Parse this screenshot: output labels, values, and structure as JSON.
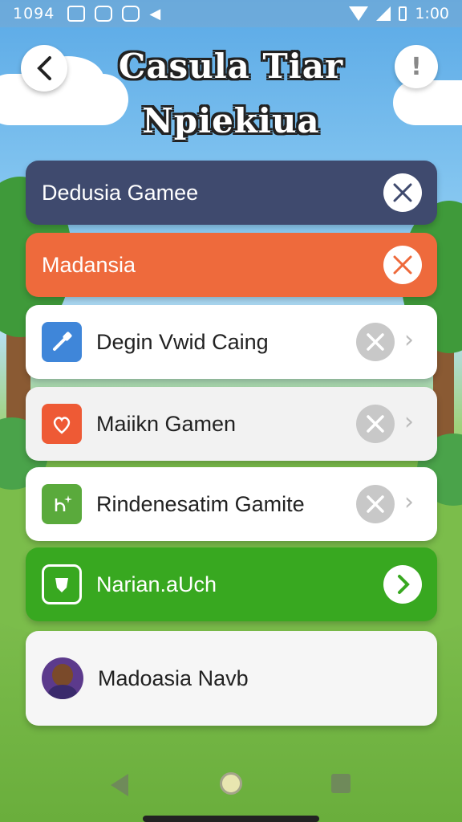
{
  "status_bar": {
    "time_left": "1094",
    "time_right": "1:00"
  },
  "header": {
    "title_line1": "Casula Tiar",
    "title_line2": "Npiekiua",
    "help_label": "!"
  },
  "rows": [
    {
      "label": "Dedusia Gamee",
      "action": "close",
      "style": "navy"
    },
    {
      "label": "Madansia",
      "action": "close",
      "style": "orange"
    },
    {
      "label": "Degin Vwid Caing",
      "action": "close",
      "style": "white"
    },
    {
      "label": "Maiikn Gamen",
      "action": "close",
      "style": "white"
    },
    {
      "label": "Rindenesatim Gamite",
      "action": "close",
      "style": "white"
    },
    {
      "label": "Narian.aUch",
      "action": "next",
      "style": "green"
    },
    {
      "label": "Madoasia Navb",
      "action": "profile",
      "style": "white"
    }
  ],
  "colors": {
    "navy": "#3f4a6e",
    "orange": "#ee6a3c",
    "green": "#38a820",
    "white": "#ffffff"
  }
}
